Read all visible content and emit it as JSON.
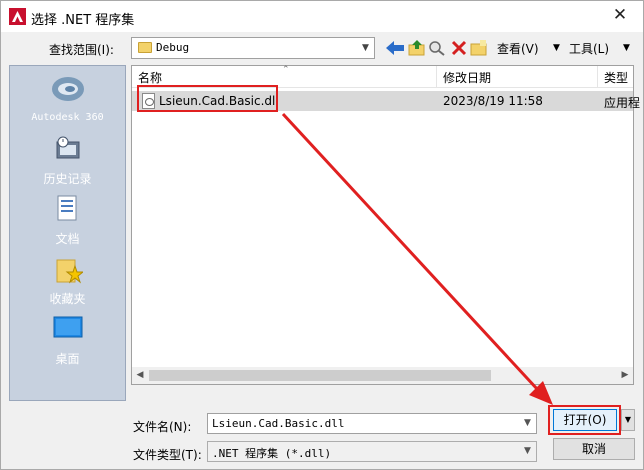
{
  "window": {
    "title": "选择 .NET 程序集",
    "close_glyph": "✕"
  },
  "lookin": {
    "label": "查找范围(I):",
    "value": "Debug"
  },
  "toolbar": {
    "view_label": "查看(V)",
    "tools_label": "工具(L)"
  },
  "places": [
    {
      "label": "Autodesk 360",
      "icon": "autodesk-360-icon"
    },
    {
      "label": "历史记录",
      "icon": "history-icon"
    },
    {
      "label": "文档",
      "icon": "documents-icon"
    },
    {
      "label": "收藏夹",
      "icon": "favorites-icon"
    },
    {
      "label": "桌面",
      "icon": "desktop-icon"
    }
  ],
  "file_list": {
    "columns": [
      "名称",
      "修改日期",
      "类型"
    ],
    "rows": [
      {
        "name": "Lsieun.Cad.Basic.dll",
        "modified": "2023/8/19 11:58",
        "type": "应用程"
      }
    ]
  },
  "filename": {
    "label": "文件名(N):",
    "value": "Lsieun.Cad.Basic.dll"
  },
  "filetype": {
    "label": "文件类型(T):",
    "value": ".NET 程序集 (*.dll)"
  },
  "buttons": {
    "open": "打开(O)",
    "cancel": "取消"
  },
  "colors": {
    "annotation_red": "#e02020",
    "selection_gray": "#d9d9d9",
    "places_bg": "#c7d1df"
  }
}
